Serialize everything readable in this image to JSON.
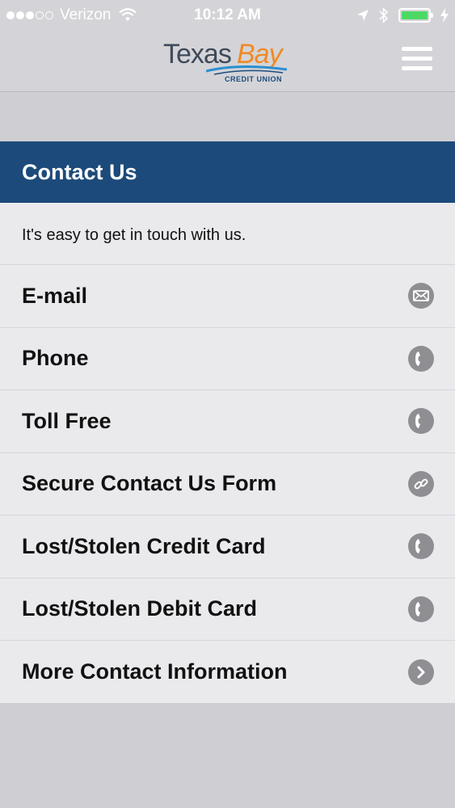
{
  "status_bar": {
    "carrier": "Verizon",
    "time": "10:12 AM",
    "battery_color": "#4cd964"
  },
  "header": {
    "logo_texas": "Texas",
    "logo_bay": "Bay",
    "logo_sub": "CREDIT UNION",
    "menu_icon": "hamburger-icon"
  },
  "page": {
    "title": "Contact Us",
    "intro": "It's easy to get in touch with us.",
    "title_bar_color": "#1c4a7a"
  },
  "items": [
    {
      "label": "E-mail",
      "icon": "envelope-icon"
    },
    {
      "label": "Phone",
      "icon": "phone-icon"
    },
    {
      "label": "Toll Free",
      "icon": "phone-icon"
    },
    {
      "label": "Secure Contact Us Form",
      "icon": "link-icon"
    },
    {
      "label": "Lost/Stolen Credit Card",
      "icon": "phone-icon"
    },
    {
      "label": "Lost/Stolen Debit Card",
      "icon": "phone-icon"
    },
    {
      "label": "More Contact Information",
      "icon": "chevron-right-icon"
    }
  ]
}
